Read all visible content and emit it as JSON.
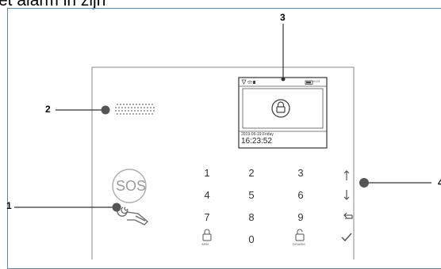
{
  "page": {
    "heading": "et alarm in zijn"
  },
  "callouts": [
    "1",
    "2",
    "3",
    "4"
  ],
  "screen": {
    "date": "2019-06-19 Friday",
    "time": "16:23:52",
    "status_time": "16:23"
  },
  "sos_label": "SOS",
  "keypad": {
    "rows": [
      [
        "1",
        "2",
        "3",
        "↑"
      ],
      [
        "4",
        "5",
        "6",
        "↓"
      ],
      [
        "7",
        "8",
        "9",
        "↩"
      ],
      [
        "",
        "0",
        "",
        "✓"
      ]
    ],
    "arm_caption": "ARM",
    "disarm_caption": "DISARM"
  },
  "icons": [
    "speaker-grille-icon",
    "lock-icon",
    "rfid-card-icon",
    "arm-lock-icon",
    "disarm-lock-icon",
    "arrow-up-icon",
    "arrow-down-icon",
    "return-icon",
    "checkmark-icon"
  ]
}
